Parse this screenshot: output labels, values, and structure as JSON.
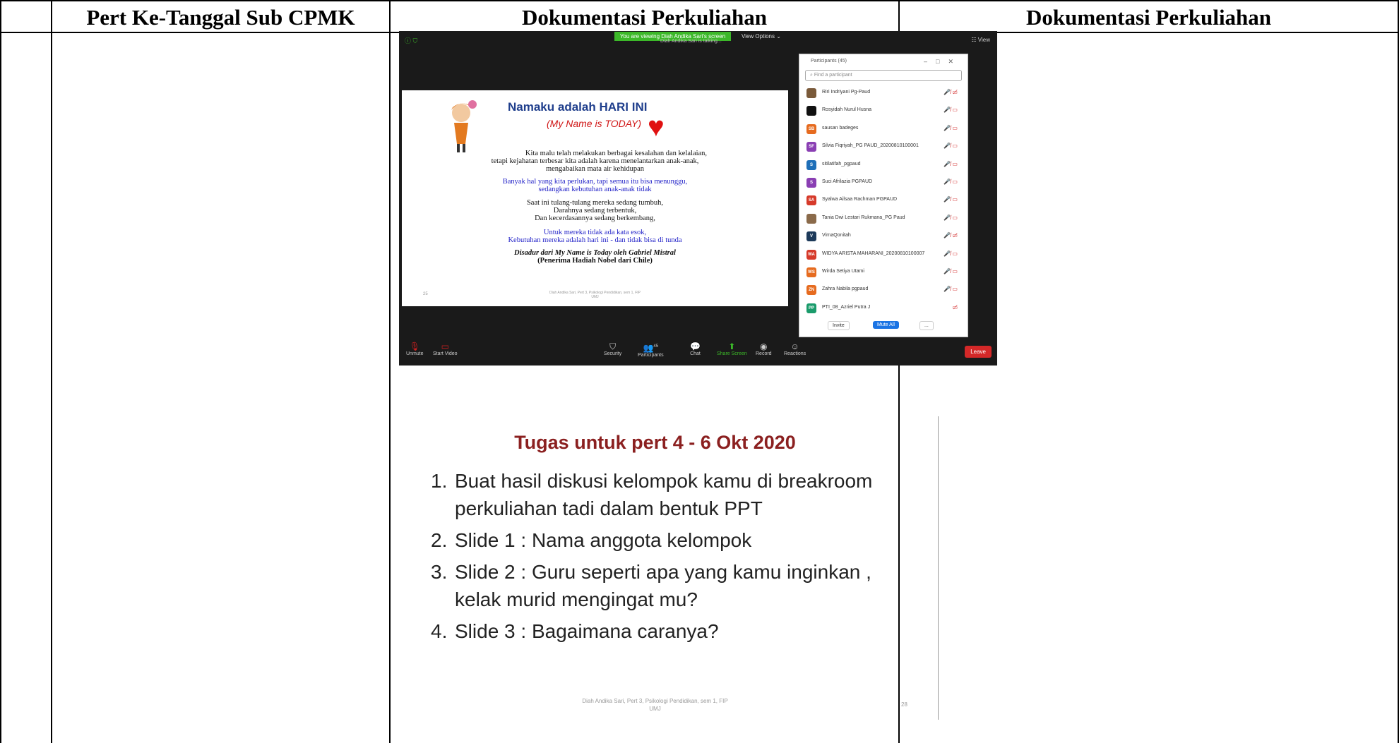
{
  "headers": [
    "Pert Ke-Tanggal Sub CPMK",
    "Dokumentasi Perkuliahan",
    "Dokumentasi Perkuliahan"
  ],
  "zoom": {
    "banner": "You are viewing Diah Andika Sari's screen",
    "view_options": "View Options ⌄",
    "talking": "Diah Andika Sari is talking...",
    "view": "☷ View",
    "slide": {
      "title": "Namaku adalah HARI INI",
      "subtitle": "(My Name is TODAY)",
      "p1": "Kita malu telah melakukan berbagai kesalahan dan kelalaian,",
      "p2": "tetapi kejahatan terbesar kita adalah  karena menelantarkan anak-anak,",
      "p3": "mengabaikan mata air kehidupan",
      "p4": "Banyak hal yang kita perlukan, tapi semua itu bisa menunggu,",
      "p5": "sedangkan kebutuhan anak-anak tidak",
      "p6": "Saat ini tulang-tulang mereka sedang tumbuh,",
      "p7": "Darahnya sedang  terbentuk,",
      "p8": "Dan kecerdasannya sedang berkembang,",
      "p9": "Untuk mereka tidak ada kata esok,",
      "p10": "Kebutuhan mereka adalah hari ini - dan tidak bisa di tunda",
      "p11": "Disadur  dari My Name is Today oleh Gabriel Mistral",
      "p12": "(Penerima Hadiah Nobel dari Chile)",
      "num": "25",
      "footer1": "Diah Andika Sari, Pert 3, Psikologi Pendidikan, sem 1, FIP",
      "footer2": "UMJ"
    },
    "participants": {
      "title": "Participants (45)",
      "search_placeholder": "Find a participant",
      "list": [
        {
          "initials": "",
          "name": "Riri Indriyani Pg-Paud",
          "color": "#7a5a3a",
          "icon": "🎤̸ ▭̸"
        },
        {
          "initials": "",
          "name": "Rosyidah Nurul Husna",
          "color": "#111111",
          "icon": "🎤̸ ▭"
        },
        {
          "initials": "SB",
          "name": "sausan badeges",
          "color": "#e66b1f",
          "icon": "🎤̸ ▭"
        },
        {
          "initials": "SF",
          "name": "Silvia Fiqriyah_PG PAUD_20200810100001",
          "color": "#8a3fb3",
          "icon": "🎤̸ ▭"
        },
        {
          "initials": "S",
          "name": "sitilatifah_pgpaud",
          "color": "#1f6fb8",
          "icon": "🎤̸ ▭"
        },
        {
          "initials": "S",
          "name": "Suci Afrilazia PGPAUD",
          "color": "#8a3fb3",
          "icon": "🎤̸ ▭"
        },
        {
          "initials": "SA",
          "name": "Syalwa Ailsaa Rachman PGPAUD",
          "color": "#d63a2a",
          "icon": "🎤̸ ▭"
        },
        {
          "initials": "",
          "name": "Tania Dwi Lestari Rukmana_PG Paud",
          "color": "#8a6a4a",
          "icon": "🎤̸ ▭"
        },
        {
          "initials": "V",
          "name": "VirnaQonitah",
          "color": "#1d3a5a",
          "icon": "🎤̸ ▭̸"
        },
        {
          "initials": "WA",
          "name": "WIDYA ARISTA MAHARANI_20200810100007",
          "color": "#d63a2a",
          "icon": "🎤̸ ▭"
        },
        {
          "initials": "WS",
          "name": "Wirda Setiya Utami",
          "color": "#e66b1f",
          "icon": "🎤̸ ▭"
        },
        {
          "initials": "ZN",
          "name": "Zahra Nabila pgpaud",
          "color": "#e66b1f",
          "icon": "🎤̸ ▭"
        },
        {
          "initials": "PP",
          "name": "PTI_08_Azriel Putra J",
          "color": "#1a9b6b",
          "icon": "▭̸"
        }
      ],
      "invite": "Invite",
      "mute_all": "Mute All",
      "more": "..."
    },
    "toolbar": {
      "unmute": "Unmute",
      "start_video": "Start Video",
      "security": "Security",
      "participants": "Participants",
      "participants_count": "45",
      "chat": "Chat",
      "share": "Share Screen",
      "record": "Record",
      "reactions": "Reactions",
      "leave": "Leave"
    }
  },
  "slide2": {
    "title": "Tugas untuk pert 4 - 6 Okt 2020",
    "items": [
      {
        "n": "1.",
        "text": "Buat hasil diskusi kelompok kamu di breakroom perkuliahan tadi dalam bentuk PPT"
      },
      {
        "n": "2.",
        "text": "Slide 1 : Nama anggota kelompok"
      },
      {
        "n": "3.",
        "text": "Slide 2 : Guru seperti apa yang kamu inginkan , kelak murid mengingat mu?"
      },
      {
        "n": "4.",
        "text": "Slide 3 : Bagaimana caranya?"
      }
    ],
    "footer1": "Diah Andika Sari, Pert 3, Psikologi Pendidikan, sem 1, FIP",
    "footer2": "UMJ",
    "page": "28"
  }
}
